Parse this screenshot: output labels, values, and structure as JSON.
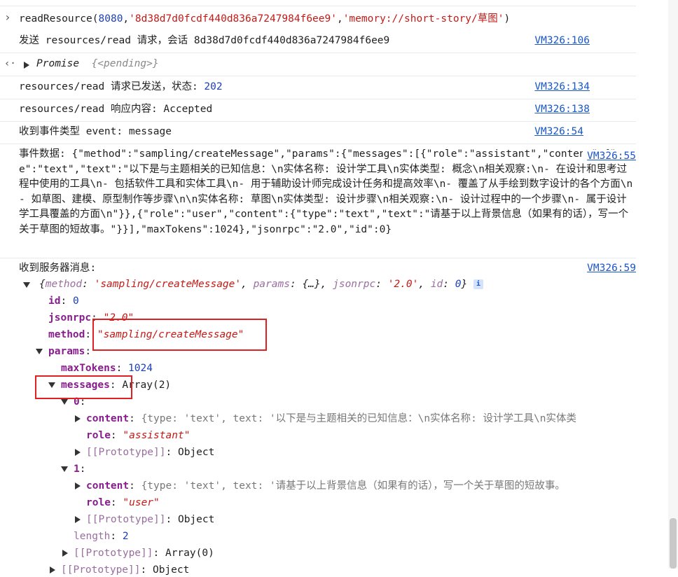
{
  "input_cmd": {
    "fn": "readResource(",
    "port": "8080",
    "comma1": ",",
    "session": "'8d38d7d0fcdf440d836a7247984f6ee9'",
    "comma2": ",",
    "uri": "'memory://short-story/草图'",
    "close": ")"
  },
  "logs": [
    {
      "text": "发送 resources/read 请求，会话 8d38d7d0fcdf440d836a7247984f6ee9",
      "link": "VM326:106"
    },
    {
      "text_prefix": "resources/read 请求已发送，状态: ",
      "value": "202",
      "link": "VM326:134"
    },
    {
      "text": "resources/read 响应内容: Accepted",
      "link": "VM326:138"
    },
    {
      "text": "收到事件类型 event: message",
      "link": "VM326:54"
    }
  ],
  "promise": {
    "label": "Promise",
    "state": "{<pending>}"
  },
  "event_data": {
    "text": "事件数据: {\"method\":\"sampling/createMessage\",\"params\":{\"messages\":[{\"role\":\"assistant\",\"content\":{\"type\":\"text\",\"text\":\"以下是与主题相关的已知信息：\\n实体名称: 设计学工具\\n实体类型: 概念\\n相关观察:\\n- 在设计和思考过程中使用的工具\\n- 包括软件工具和实体工具\\n- 用于辅助设计师完成设计任务和提高效率\\n- 覆盖了从手绘到数字设计的各个方面\\n- 如草图、建模、原型制作等步骤\\n\\n实体名称: 草图\\n实体类型: 设计步骤\\n相关观察:\\n- 设计过程中的一个步骤\\n- 属于设计学工具覆盖的方面\\n\"}},{\"role\":\"user\",\"content\":{\"type\":\"text\",\"text\":\"请基于以上背景信息（如果有的话），写一个关于草图的短故事。\"}}],\"maxTokens\":1024},\"jsonrpc\":\"2.0\",\"id\":0}",
    "link": "VM326:55"
  },
  "server_msg": {
    "label": "收到服务器消息:",
    "link": "VM326:59",
    "summary": {
      "method_key": "method",
      "method_val": "'sampling/createMessage'",
      "params_key": "params",
      "params_val": "{…}",
      "jsonrpc_key": "jsonrpc",
      "jsonrpc_val": "'2.0'",
      "id_key": "id",
      "id_val": "0",
      "info": "i"
    },
    "id": {
      "key": "id",
      "value": "0"
    },
    "jsonrpc": {
      "key": "jsonrpc",
      "value": "\"2.0\""
    },
    "method": {
      "key": "method",
      "value": "\"sampling/createMessage\""
    },
    "params": {
      "key": "params",
      "maxTokens": {
        "key": "maxTokens",
        "value": "1024"
      },
      "messages": {
        "key": "messages",
        "value": "Array(2)"
      },
      "msg0": {
        "index": "0",
        "content_key": "content",
        "content_val": "{type: 'text', text: '以下是与主题相关的已知信息：\\n实体名称: 设计学工具\\n实体类",
        "role_key": "role",
        "role_val": "\"assistant\"",
        "proto": "[[Prototype]]",
        "proto_val": "Object"
      },
      "msg1": {
        "index": "1",
        "content_key": "content",
        "content_val": "{type: 'text', text: '请基于以上背景信息（如果有的话），写一个关于草图的短故事。",
        "role_key": "role",
        "role_val": "\"user\"",
        "proto": "[[Prototype]]",
        "proto_val": "Object"
      },
      "length": {
        "key": "length",
        "value": "2"
      },
      "arr_proto": {
        "key": "[[Prototype]]",
        "value": "Array(0)"
      }
    },
    "last_proto": {
      "key": "[[Prototype]]",
      "value": "Object"
    }
  }
}
